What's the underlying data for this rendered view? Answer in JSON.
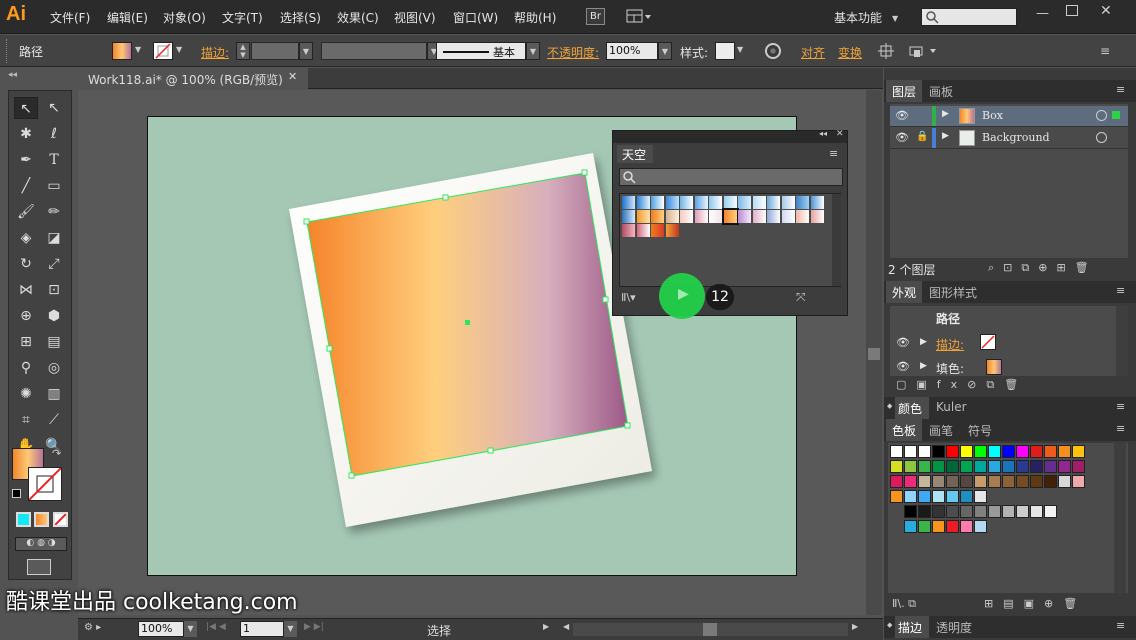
{
  "app": {
    "logo": "Ai",
    "menus": [
      "文件(F)",
      "编辑(E)",
      "对象(O)",
      "文字(T)",
      "选择(S)",
      "效果(C)",
      "视图(V)",
      "窗口(W)",
      "帮助(H)"
    ],
    "bridge_label": "Br",
    "workspace": "基本功能",
    "search_placeholder": ""
  },
  "control_bar": {
    "object_type": "路径",
    "stroke_label": "描边:",
    "stroke_style": "基本",
    "opacity_label": "不透明度:",
    "opacity_value": "100%",
    "style_label": "样式:",
    "align_label": "对齐",
    "transform_label": "变换"
  },
  "document": {
    "tab_title": "Work118.ai* @ 100% (RGB/预览)",
    "close_glyph": "✕"
  },
  "gradient_panel": {
    "tab": "天空",
    "counter": "12"
  },
  "layers_panel": {
    "tabs": [
      "图层",
      "画板"
    ],
    "layers": [
      {
        "name": "Box",
        "locked": false,
        "selected": true,
        "color": "#2fb24a"
      },
      {
        "name": "Background",
        "locked": true,
        "selected": false,
        "color": "#4a7fd6"
      }
    ],
    "footer": "2 个图层"
  },
  "appearance_panel": {
    "tabs": [
      "外观",
      "图形样式"
    ],
    "title": "路径",
    "rows": [
      {
        "label": "描边:"
      },
      {
        "label": "填色:"
      }
    ]
  },
  "color_panel": {
    "tabs": [
      "颜色",
      "Kuler"
    ]
  },
  "swatches_panel": {
    "tabs": [
      "色板",
      "画笔",
      "符号"
    ]
  },
  "bottom_panel": {
    "tabs": [
      "描边",
      "透明度"
    ]
  },
  "status": {
    "zoom": "100%",
    "artboard_number": "1",
    "tool": "选择"
  },
  "watermark": "酷课堂出品 coolketang.com"
}
